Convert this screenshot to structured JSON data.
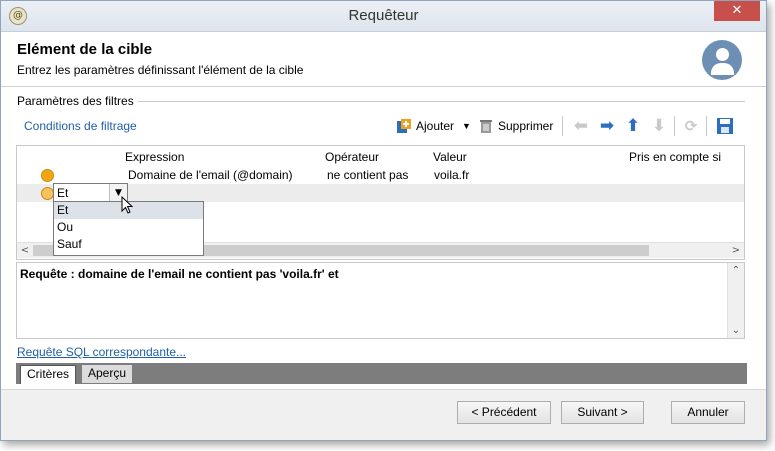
{
  "window": {
    "title": "Requêteur",
    "close_symbol": "✕"
  },
  "header": {
    "title": "Elément de la cible",
    "subtitle": "Entrez les paramètres définissant l'élément de la cible"
  },
  "filters": {
    "section_label": "Paramètres des filtres"
  },
  "toolbar": {
    "conditions_link": "Conditions de filtrage",
    "add_label": "Ajouter",
    "delete_label": "Supprimer"
  },
  "grid": {
    "columns": [
      "Expression",
      "Opérateur",
      "Valeur",
      "Pris en compte si"
    ],
    "rows": [
      {
        "expression": "Domaine de l'email (@domain)",
        "operator": "ne contient pas",
        "value": "voila.fr"
      }
    ],
    "logic_combo": {
      "value": "Et",
      "options": [
        "Et",
        "Ou",
        "Sauf"
      ],
      "selected_index": 0
    }
  },
  "query": {
    "text": "Requête : domaine de l'email ne contient pas 'voila.fr' et"
  },
  "sql_link": "Requête SQL correspondante...",
  "tabs": [
    "Critères",
    "Aperçu"
  ],
  "buttons": {
    "previous": "< Précédent",
    "next": "Suivant >",
    "cancel": "Annuler"
  },
  "colors": {
    "accent_blue": "#1f5fa8",
    "condition_dot": "#f2a516",
    "close_red": "#c7504c",
    "avatar": "#6d8fb4"
  }
}
